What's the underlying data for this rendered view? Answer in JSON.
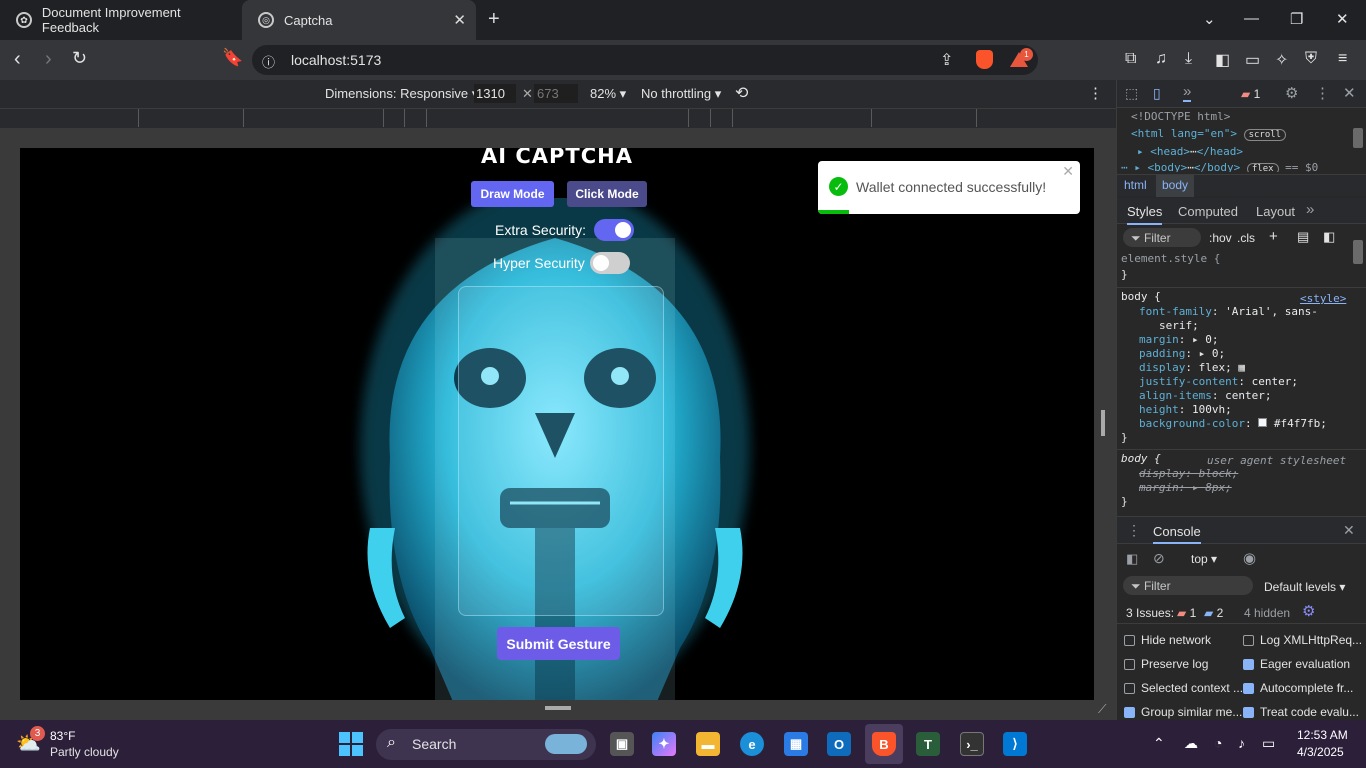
{
  "browser": {
    "tabs": [
      {
        "title": "Document Improvement Feedback"
      },
      {
        "title": "Captcha"
      }
    ],
    "url": "localhost:5173",
    "extension_badge": "1"
  },
  "device_toolbar": {
    "dimensions_label": "Dimensions: Responsive",
    "width": "1310",
    "height": "673",
    "zoom": "82%",
    "throttling": "No throttling"
  },
  "page": {
    "title": "AI CAPTCHA",
    "draw_mode": "Draw Mode",
    "click_mode": "Click Mode",
    "extra_security_label": "Extra Security:",
    "extra_security_on": true,
    "hyper_security_label": "Hyper Security",
    "hyper_security_on": false,
    "submit_label": "Submit Gesture",
    "accent_color": "#6366f1"
  },
  "toast": {
    "message": "Wallet connected successfully!",
    "progress": 0.12
  },
  "devtools": {
    "issues_badge": "1",
    "elements": [
      "<!DOCTYPE html>",
      "<html lang=\"en\">",
      "<head>",
      "</head>",
      "<body>",
      "</body>",
      "== $0"
    ],
    "scroll_badge": "scroll",
    "flex_badge": "flex",
    "crumbs": [
      "html",
      "body"
    ],
    "panel_tabs": [
      "Styles",
      "Computed",
      "Layout"
    ],
    "filter_placeholder": "Filter",
    "hov": ":hov",
    "cls": ".cls",
    "element_style": "element.style {",
    "close_brace": "}",
    "body_rule": {
      "selector": "body {",
      "source": "<style>",
      "decls": [
        {
          "p": "font-family",
          "v": "'Arial', sans-"
        },
        {
          "p": "",
          "v": "serif;"
        },
        {
          "p": "margin",
          "v": "0;"
        },
        {
          "p": "padding",
          "v": "0;"
        },
        {
          "p": "display",
          "v": "flex;"
        },
        {
          "p": "justify-content",
          "v": "center;"
        },
        {
          "p": "align-items",
          "v": "center;"
        },
        {
          "p": "height",
          "v": "100vh;"
        },
        {
          "p": "background-color",
          "v": "#f4f7fb;"
        }
      ]
    },
    "ua_rule": {
      "selector": "body {",
      "source": "user agent stylesheet",
      "decls": [
        {
          "p": "display",
          "v": "block;"
        },
        {
          "p": "margin",
          "v": "8px;"
        }
      ]
    },
    "console": {
      "title": "Console",
      "context": "top",
      "filter_placeholder": "Filter",
      "levels": "Default levels",
      "issues_label": "3 Issues:",
      "issues_errors": "1",
      "issues_info": "2",
      "hidden": "4 hidden",
      "options": [
        {
          "label": "Hide network",
          "checked": false
        },
        {
          "label": "Log XMLHttpReq...",
          "checked": false
        },
        {
          "label": "Preserve log",
          "checked": false
        },
        {
          "label": "Eager evaluation",
          "checked": true
        },
        {
          "label": "Selected context ...",
          "checked": false
        },
        {
          "label": "Autocomplete fr...",
          "checked": true
        },
        {
          "label": "Group similar me...",
          "checked": true
        },
        {
          "label": "Treat code evalu...",
          "checked": true
        }
      ]
    }
  },
  "taskbar": {
    "weather_temp": "83°F",
    "weather_desc": "Partly cloudy",
    "weather_badge": "3",
    "search_label": "Search",
    "time": "12:53 AM",
    "date": "4/3/2025"
  }
}
